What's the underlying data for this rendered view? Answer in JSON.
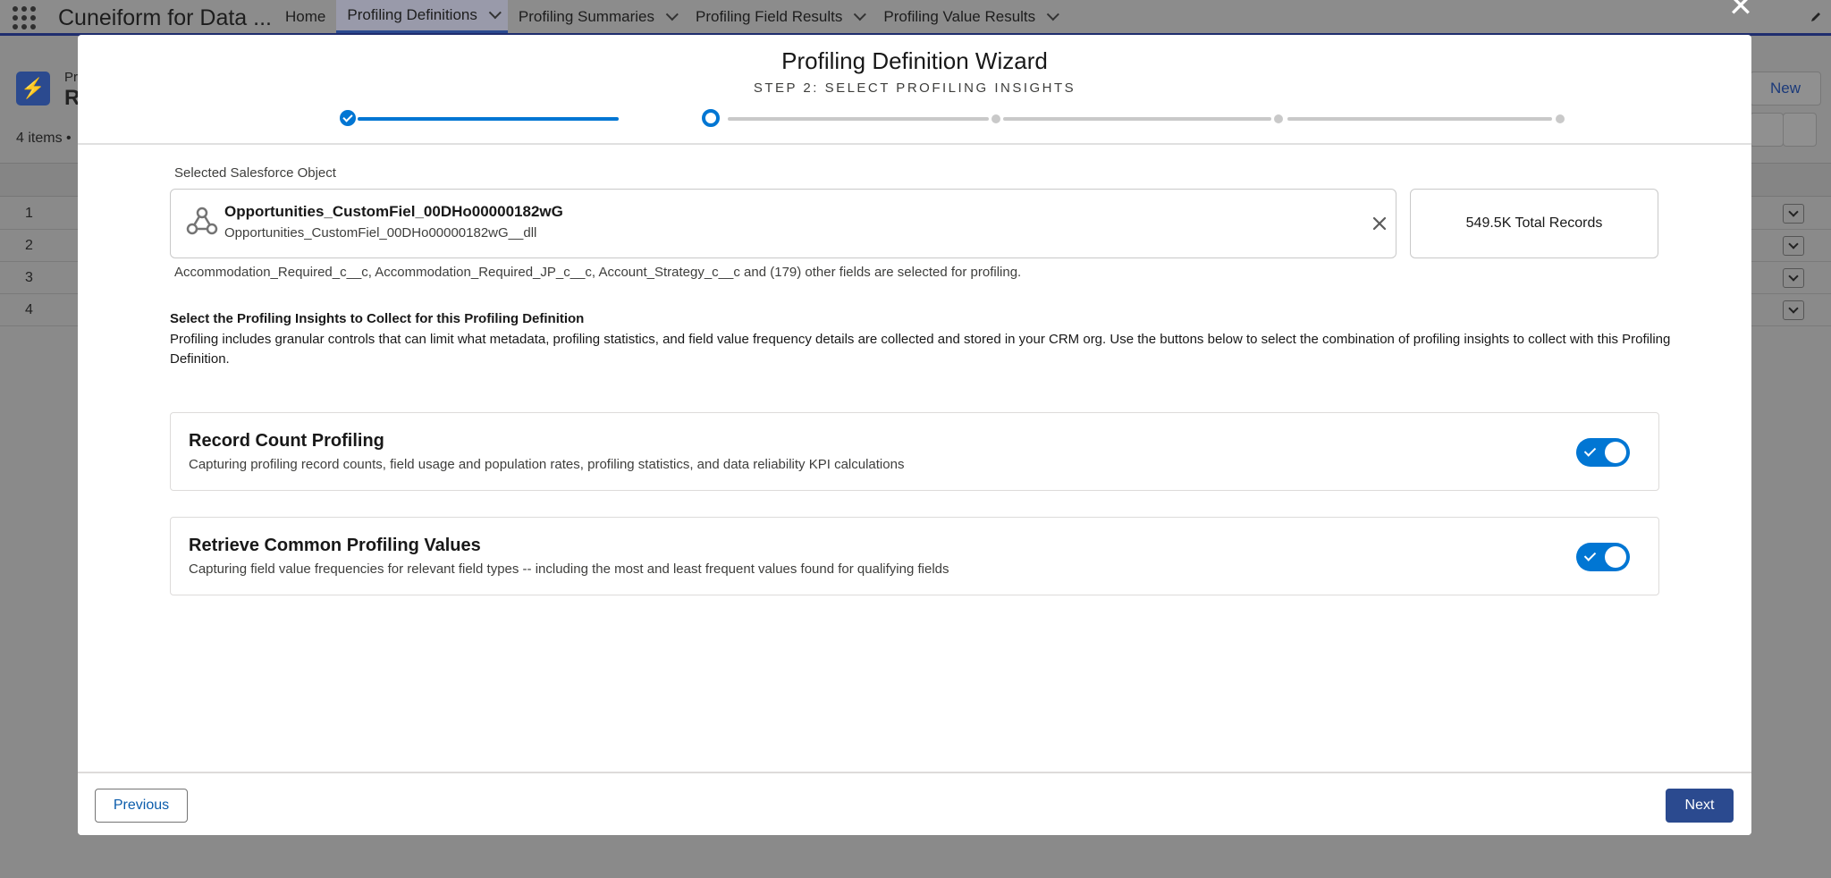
{
  "app": {
    "name": "Cuneiform for Data ...",
    "nav": [
      {
        "label": "Home",
        "has_menu": false,
        "active": false
      },
      {
        "label": "Profiling Definitions",
        "has_menu": true,
        "active": true
      },
      {
        "label": "Profiling Summaries",
        "has_menu": true,
        "active": false
      },
      {
        "label": "Profiling Field Results",
        "has_menu": true,
        "active": false
      },
      {
        "label": "Profiling Value Results",
        "has_menu": true,
        "active": false
      }
    ]
  },
  "background": {
    "object_small": "Pr",
    "object_big": "R",
    "items_count": "4 items • ",
    "new_button": "New",
    "rows": [
      "1",
      "2",
      "3",
      "4"
    ]
  },
  "modal": {
    "title": "Profiling Definition Wizard",
    "subtitle": "STEP 2: SELECT PROFILING INSIGHTS",
    "progress": {
      "total_steps": 5,
      "current_step": 2
    },
    "selected_label": "Selected Salesforce Object",
    "object": {
      "name": "Opportunities_CustomFiel_00DHo00000182wG",
      "api_name": "Opportunities_CustomFiel_00DHo00000182wG__dll",
      "icon": "object-network-icon"
    },
    "total_records": "549.5K Total Records",
    "fields_note": "Accommodation_Required_c__c, Accommodation_Required_JP_c__c, Account_Strategy_c__c and (179) other fields are selected for profiling.",
    "insights_title": "Select the Profiling Insights to Collect for this Profiling Definition",
    "insights_desc": "Profiling includes granular controls that can limit what metadata, profiling statistics, and field value frequency details are collected and stored in your CRM org. Use the buttons below to select the combination of profiling insights to collect with this Profiling Definition.",
    "cards": [
      {
        "title": "Record Count Profiling",
        "desc": "Capturing profiling record counts, field usage and population rates, profiling statistics, and data reliability KPI calculations",
        "enabled": true
      },
      {
        "title": "Retrieve Common Profiling Values",
        "desc": "Capturing field value frequencies for relevant field types -- including the most and least frequent values found for qualifying fields",
        "enabled": true
      }
    ],
    "previous_label": "Previous",
    "next_label": "Next"
  },
  "colors": {
    "brand": "#0176d3",
    "next_button": "#2b4a8f",
    "overlay": "#8a8a8a"
  }
}
